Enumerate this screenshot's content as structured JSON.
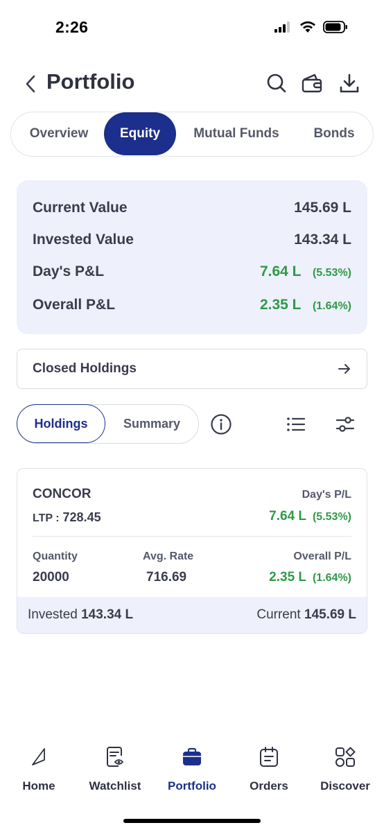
{
  "status_bar": {
    "time": "2:26"
  },
  "header": {
    "title": "Portfolio",
    "icons": [
      "chevron-left-icon",
      "search-icon",
      "wallet-icon",
      "download-icon"
    ]
  },
  "tabs": [
    {
      "label": "Overview",
      "active": false
    },
    {
      "label": "Equity",
      "active": true
    },
    {
      "label": "Mutual Funds",
      "active": false
    },
    {
      "label": "Bonds",
      "active": false
    }
  ],
  "summary": {
    "current_value": {
      "label": "Current Value",
      "value": "145.69 L"
    },
    "invested_value": {
      "label": "Invested Value",
      "value": "143.34 L"
    },
    "days_pl": {
      "label": "Day's P&L",
      "value": "7.64 L",
      "percent": "(5.53%)"
    },
    "overall_pl": {
      "label": "Overall P&L",
      "value": "2.35 L",
      "percent": "(1.64%)"
    }
  },
  "closed_holdings": {
    "label": "Closed Holdings",
    "icon": "arrow-right-icon"
  },
  "view_toggle": {
    "holdings": "Holdings",
    "summary": "Summary",
    "active": "Holdings"
  },
  "tools": [
    "info-icon",
    "list-icon",
    "filter-icon"
  ],
  "holdings": [
    {
      "name": "CONCOR",
      "ltp_label": "LTP :",
      "ltp": "728.45",
      "day_pl_label": "Day's P/L",
      "day_pl": "7.64 L",
      "day_pl_pct": "(5.53%)",
      "quantity_label": "Quantity",
      "quantity": "20000",
      "avg_rate_label": "Avg. Rate",
      "avg_rate": "716.69",
      "overall_pl_label": "Overall P/L",
      "overall_pl": "2.35 L",
      "overall_pl_pct": "(1.64%)",
      "invested_label": "Invested",
      "invested": "143.34 L",
      "current_label": "Current",
      "current": "145.69 L"
    }
  ],
  "bottom_nav": [
    {
      "label": "Home",
      "icon": "home-icon",
      "active": false
    },
    {
      "label": "Watchlist",
      "icon": "watchlist-icon",
      "active": false
    },
    {
      "label": "Portfolio",
      "icon": "portfolio-icon",
      "active": true
    },
    {
      "label": "Orders",
      "icon": "orders-icon",
      "active": false
    },
    {
      "label": "Discover",
      "icon": "discover-icon",
      "active": false
    }
  ],
  "colors": {
    "primary": "#1c2f8c",
    "profit": "#2e9a47",
    "card_bg": "#eef0fb",
    "text": "#3a3c4e"
  }
}
